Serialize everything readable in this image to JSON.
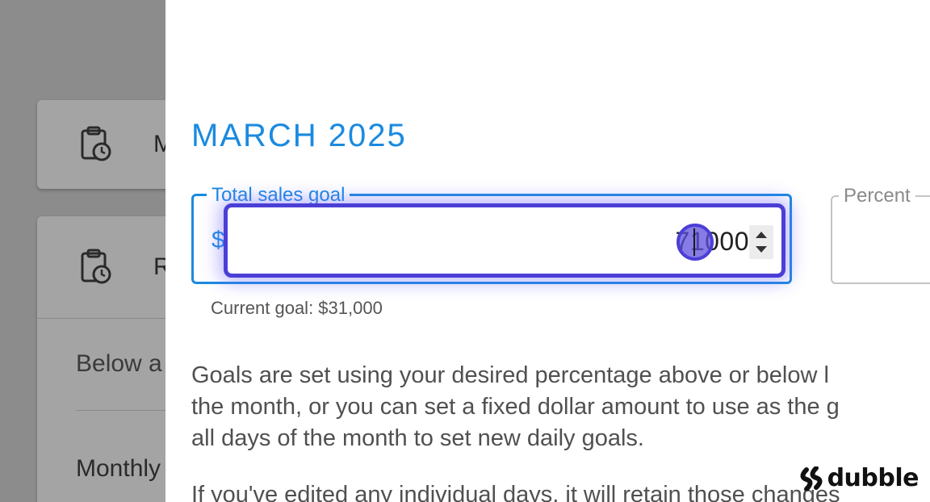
{
  "background": {
    "cards": [
      {
        "letter": "M"
      },
      {
        "letter": "R",
        "text_below": "Below a",
        "text_monthly": "Monthly"
      }
    ]
  },
  "drawer": {
    "month_title": "MARCH 2025",
    "goal_field": {
      "label": "Total sales goal",
      "prefix": "$",
      "value": "71000",
      "helper": "Current goal: $31,000"
    },
    "percent_field": {
      "label": "Percent"
    },
    "description": [
      "Goals are set using your desired percentage above or below l",
      "the month, or you can set a fixed dollar amount to use as the g",
      "all days of the month to set new daily goals."
    ],
    "description_next": "If you've edited any individual days, it will retain those changes"
  },
  "watermark": {
    "text": "dubble"
  },
  "colors": {
    "accent": "#1a8ae0",
    "focus_ring": "#4b3fd6",
    "overlay": "#8c8c8c"
  }
}
